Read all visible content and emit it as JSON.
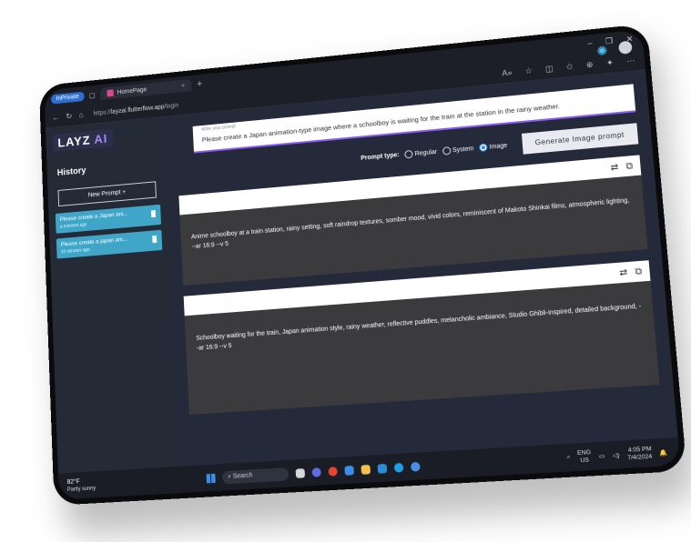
{
  "browser": {
    "profile": "InPrivate",
    "tab_title": "HomePage",
    "tab_close": "×",
    "new_tab": "+",
    "url_prefix": "https://",
    "url_host": "layzai.flutterflow.app",
    "url_path": "/login",
    "window_controls": [
      "–",
      "❐",
      "✕"
    ]
  },
  "app": {
    "logo_main": "LAYZ",
    "logo_ai": "AI"
  },
  "sidebar": {
    "history_title": "History",
    "new_prompt_label": "New Prompt  +",
    "items": [
      {
        "title": "Please create a Japan ani...",
        "time": "a moment ago"
      },
      {
        "title": "Please create a japan ani...",
        "time": "10 minutes ago"
      }
    ]
  },
  "prompt": {
    "label": "Write your prompt",
    "text": "Please create a Japan animation-type image where a schoolboy is waiting for the train at the station in the rainy weather."
  },
  "prompt_type": {
    "label": "Prompt type:",
    "options": [
      "Regular",
      "System",
      "Image"
    ],
    "selected": "Image"
  },
  "generate_button": "Generate Image prompt",
  "results": [
    {
      "text": "Anime schoolboy at a train station, rainy setting, soft raindrop textures, somber mood, vivid colors, reminiscent of Makoto Shinkai films, atmospheric lighting, --ar 16:9 --v 5"
    },
    {
      "text": "Schoolboy waiting for the train, Japan animation style, rainy weather, reflective puddles, melancholic ambiance, Studio Ghibli-inspired, detailed background, --ar 16:9 --v 5"
    }
  ],
  "taskbar": {
    "weather_temp": "82°F",
    "weather_desc": "Partly sunny",
    "search_placeholder": "Search",
    "lang_top": "ENG",
    "lang_bottom": "US",
    "time": "4:05 PM",
    "date": "7/4/2024"
  },
  "colors": {
    "accent": "#8b5cf6",
    "history_item": "#3fa6c9",
    "app_bg": "#242a3a",
    "result_bg": "#3b3b3e"
  }
}
